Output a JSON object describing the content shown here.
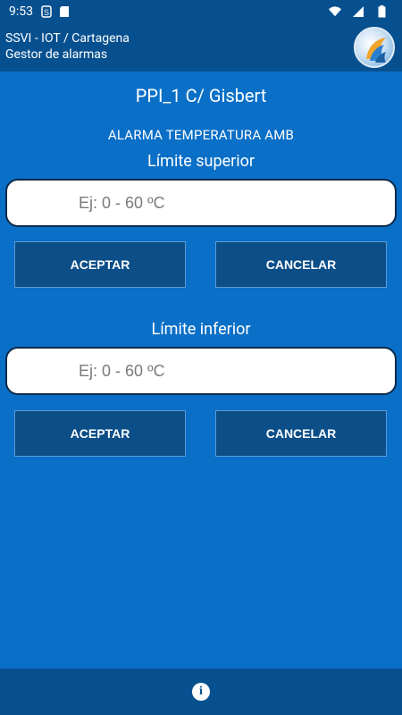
{
  "status_bar": {
    "time": "9:53"
  },
  "app_bar": {
    "title": "SSVI - IOT / Cartagena",
    "subtitle": "Gestor de alarmas"
  },
  "page": {
    "title": "PPI_1 C/ Gisbert",
    "alarm_type": "ALARMA TEMPERATURA AMB"
  },
  "upper": {
    "label": "Límite superior",
    "placeholder": "Ej: 0 - 60 ºC",
    "accept": "ACEPTAR",
    "cancel": "CANCELAR"
  },
  "lower": {
    "label": "Límite inferior",
    "placeholder": "Ej: 0 - 60 ºC",
    "accept": "ACEPTAR",
    "cancel": "CANCELAR"
  },
  "icons": {
    "status": [
      "sim-card-icon",
      "sd-card-icon",
      "wifi-icon",
      "signal-icon",
      "battery-icon"
    ],
    "bottom": "info-icon"
  },
  "colors": {
    "background": "#0a6fc7",
    "bar": "#07508f",
    "button": "#0b4e88"
  }
}
